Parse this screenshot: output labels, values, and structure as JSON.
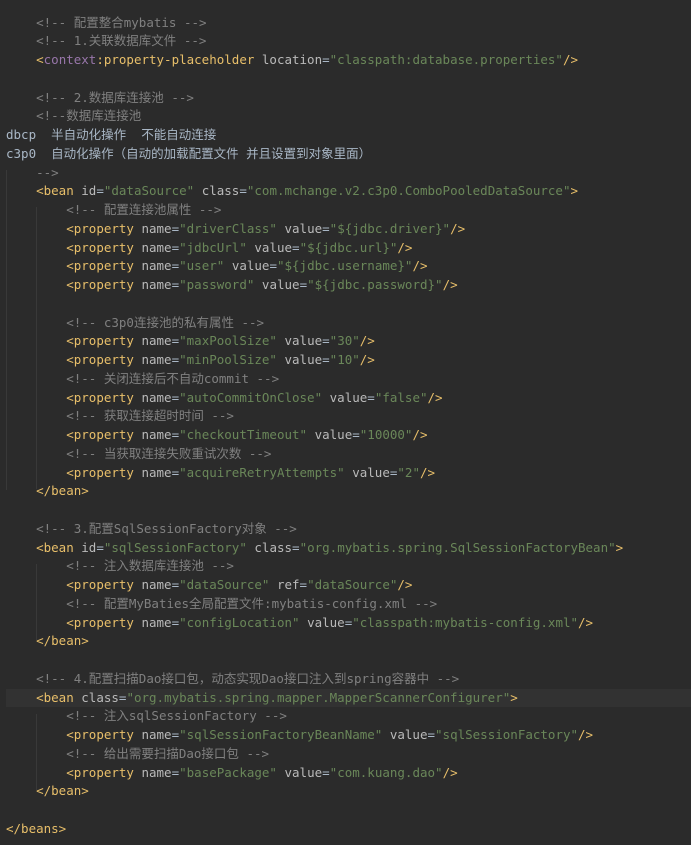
{
  "editor": {
    "colors": {
      "background": "#2b2b2b",
      "comment": "#808080",
      "tag": "#e8bf6a",
      "attribute": "#bababa",
      "value": "#6a8759",
      "namespace": "#9876aa",
      "text": "#a9b7c6"
    },
    "lines": [
      [
        {
          "t": "plain",
          "v": "    "
        },
        {
          "t": "comment",
          "v": "<!-- 配置整合mybatis -->"
        }
      ],
      [
        {
          "t": "plain",
          "v": "    "
        },
        {
          "t": "comment",
          "v": "<!-- 1.关联数据库文件 -->"
        }
      ],
      [
        {
          "t": "plain",
          "v": "    "
        },
        {
          "t": "tag",
          "v": "<"
        },
        {
          "t": "ns",
          "v": "context"
        },
        {
          "t": "tag",
          "v": ":property-placeholder "
        },
        {
          "t": "attr",
          "v": "location"
        },
        {
          "t": "plain",
          "v": "="
        },
        {
          "t": "val",
          "v": "\"classpath:database.properties\""
        },
        {
          "t": "tag",
          "v": "/>"
        }
      ],
      [],
      [
        {
          "t": "plain",
          "v": "    "
        },
        {
          "t": "comment",
          "v": "<!-- 2.数据库连接池 -->"
        }
      ],
      [
        {
          "t": "plain",
          "v": "    "
        },
        {
          "t": "comment",
          "v": "<!--数据库连接池"
        }
      ],
      [
        {
          "t": "text",
          "v": "dbcp  半自动化操作  不能自动连接"
        }
      ],
      [
        {
          "t": "text",
          "v": "c3p0  自动化操作（自动的加载配置文件 并且设置到对象里面）"
        }
      ],
      [
        {
          "t": "plain",
          "v": "    "
        },
        {
          "t": "comment",
          "v": "-->"
        }
      ],
      [
        {
          "t": "plain",
          "v": "    "
        },
        {
          "t": "tag",
          "v": "<bean "
        },
        {
          "t": "attr",
          "v": "id"
        },
        {
          "t": "plain",
          "v": "="
        },
        {
          "t": "val",
          "v": "\"dataSource\""
        },
        {
          "t": "plain",
          "v": " "
        },
        {
          "t": "attr",
          "v": "class"
        },
        {
          "t": "plain",
          "v": "="
        },
        {
          "t": "val",
          "v": "\"com.mchange.v2.c3p0.ComboPooledDataSource\""
        },
        {
          "t": "tag",
          "v": ">"
        }
      ],
      [
        {
          "t": "plain",
          "v": "        "
        },
        {
          "t": "comment",
          "v": "<!-- 配置连接池属性 -->"
        }
      ],
      [
        {
          "t": "plain",
          "v": "        "
        },
        {
          "t": "tag",
          "v": "<property "
        },
        {
          "t": "attr",
          "v": "name"
        },
        {
          "t": "plain",
          "v": "="
        },
        {
          "t": "val",
          "v": "\"driverClass\""
        },
        {
          "t": "plain",
          "v": " "
        },
        {
          "t": "attr",
          "v": "value"
        },
        {
          "t": "plain",
          "v": "="
        },
        {
          "t": "val",
          "v": "\"${jdbc.driver}\""
        },
        {
          "t": "tag",
          "v": "/>"
        }
      ],
      [
        {
          "t": "plain",
          "v": "        "
        },
        {
          "t": "tag",
          "v": "<property "
        },
        {
          "t": "attr",
          "v": "name"
        },
        {
          "t": "plain",
          "v": "="
        },
        {
          "t": "val",
          "v": "\"jdbcUrl\""
        },
        {
          "t": "plain",
          "v": " "
        },
        {
          "t": "attr",
          "v": "value"
        },
        {
          "t": "plain",
          "v": "="
        },
        {
          "t": "val",
          "v": "\"${jdbc.url}\""
        },
        {
          "t": "tag",
          "v": "/>"
        }
      ],
      [
        {
          "t": "plain",
          "v": "        "
        },
        {
          "t": "tag",
          "v": "<property "
        },
        {
          "t": "attr",
          "v": "name"
        },
        {
          "t": "plain",
          "v": "="
        },
        {
          "t": "val",
          "v": "\"user\""
        },
        {
          "t": "plain",
          "v": " "
        },
        {
          "t": "attr",
          "v": "value"
        },
        {
          "t": "plain",
          "v": "="
        },
        {
          "t": "val",
          "v": "\"${jdbc.username}\""
        },
        {
          "t": "tag",
          "v": "/>"
        }
      ],
      [
        {
          "t": "plain",
          "v": "        "
        },
        {
          "t": "tag",
          "v": "<property "
        },
        {
          "t": "attr",
          "v": "name"
        },
        {
          "t": "plain",
          "v": "="
        },
        {
          "t": "val",
          "v": "\"password\""
        },
        {
          "t": "plain",
          "v": " "
        },
        {
          "t": "attr",
          "v": "value"
        },
        {
          "t": "plain",
          "v": "="
        },
        {
          "t": "val",
          "v": "\"${jdbc.password}\""
        },
        {
          "t": "tag",
          "v": "/>"
        }
      ],
      [],
      [
        {
          "t": "plain",
          "v": "        "
        },
        {
          "t": "comment",
          "v": "<!-- c3p0连接池的私有属性 -->"
        }
      ],
      [
        {
          "t": "plain",
          "v": "        "
        },
        {
          "t": "tag",
          "v": "<property "
        },
        {
          "t": "attr",
          "v": "name"
        },
        {
          "t": "plain",
          "v": "="
        },
        {
          "t": "val",
          "v": "\"maxPoolSize\""
        },
        {
          "t": "plain",
          "v": " "
        },
        {
          "t": "attr",
          "v": "value"
        },
        {
          "t": "plain",
          "v": "="
        },
        {
          "t": "val",
          "v": "\"30\""
        },
        {
          "t": "tag",
          "v": "/>"
        }
      ],
      [
        {
          "t": "plain",
          "v": "        "
        },
        {
          "t": "tag",
          "v": "<property "
        },
        {
          "t": "attr",
          "v": "name"
        },
        {
          "t": "plain",
          "v": "="
        },
        {
          "t": "val",
          "v": "\"minPoolSize\""
        },
        {
          "t": "plain",
          "v": " "
        },
        {
          "t": "attr",
          "v": "value"
        },
        {
          "t": "plain",
          "v": "="
        },
        {
          "t": "val",
          "v": "\"10\""
        },
        {
          "t": "tag",
          "v": "/>"
        }
      ],
      [
        {
          "t": "plain",
          "v": "        "
        },
        {
          "t": "comment",
          "v": "<!-- 关闭连接后不自动commit -->"
        }
      ],
      [
        {
          "t": "plain",
          "v": "        "
        },
        {
          "t": "tag",
          "v": "<property "
        },
        {
          "t": "attr",
          "v": "name"
        },
        {
          "t": "plain",
          "v": "="
        },
        {
          "t": "val",
          "v": "\"autoCommitOnClose\""
        },
        {
          "t": "plain",
          "v": " "
        },
        {
          "t": "attr",
          "v": "value"
        },
        {
          "t": "plain",
          "v": "="
        },
        {
          "t": "val",
          "v": "\"false\""
        },
        {
          "t": "tag",
          "v": "/>"
        }
      ],
      [
        {
          "t": "plain",
          "v": "        "
        },
        {
          "t": "comment",
          "v": "<!-- 获取连接超时时间 -->"
        }
      ],
      [
        {
          "t": "plain",
          "v": "        "
        },
        {
          "t": "tag",
          "v": "<property "
        },
        {
          "t": "attr",
          "v": "name"
        },
        {
          "t": "plain",
          "v": "="
        },
        {
          "t": "val",
          "v": "\"checkoutTimeout\""
        },
        {
          "t": "plain",
          "v": " "
        },
        {
          "t": "attr",
          "v": "value"
        },
        {
          "t": "plain",
          "v": "="
        },
        {
          "t": "val",
          "v": "\"10000\""
        },
        {
          "t": "tag",
          "v": "/>"
        }
      ],
      [
        {
          "t": "plain",
          "v": "        "
        },
        {
          "t": "comment",
          "v": "<!-- 当获取连接失败重试次数 -->"
        }
      ],
      [
        {
          "t": "plain",
          "v": "        "
        },
        {
          "t": "tag",
          "v": "<property "
        },
        {
          "t": "attr",
          "v": "name"
        },
        {
          "t": "plain",
          "v": "="
        },
        {
          "t": "val",
          "v": "\"acquireRetryAttempts\""
        },
        {
          "t": "plain",
          "v": " "
        },
        {
          "t": "attr",
          "v": "value"
        },
        {
          "t": "plain",
          "v": "="
        },
        {
          "t": "val",
          "v": "\"2\""
        },
        {
          "t": "tag",
          "v": "/>"
        }
      ],
      [
        {
          "t": "plain",
          "v": "    "
        },
        {
          "t": "tag",
          "v": "</bean>"
        }
      ],
      [],
      [
        {
          "t": "plain",
          "v": "    "
        },
        {
          "t": "comment",
          "v": "<!-- 3.配置SqlSessionFactory对象 -->"
        }
      ],
      [
        {
          "t": "plain",
          "v": "    "
        },
        {
          "t": "tag",
          "v": "<bean "
        },
        {
          "t": "attr",
          "v": "id"
        },
        {
          "t": "plain",
          "v": "="
        },
        {
          "t": "val",
          "v": "\"sqlSessionFactory\""
        },
        {
          "t": "plain",
          "v": " "
        },
        {
          "t": "attr",
          "v": "class"
        },
        {
          "t": "plain",
          "v": "="
        },
        {
          "t": "val",
          "v": "\"org.mybatis.spring.SqlSessionFactoryBean\""
        },
        {
          "t": "tag",
          "v": ">"
        }
      ],
      [
        {
          "t": "plain",
          "v": "        "
        },
        {
          "t": "comment",
          "v": "<!-- 注入数据库连接池 -->"
        }
      ],
      [
        {
          "t": "plain",
          "v": "        "
        },
        {
          "t": "tag",
          "v": "<property "
        },
        {
          "t": "attr",
          "v": "name"
        },
        {
          "t": "plain",
          "v": "="
        },
        {
          "t": "val",
          "v": "\"dataSource\""
        },
        {
          "t": "plain",
          "v": " "
        },
        {
          "t": "attr",
          "v": "ref"
        },
        {
          "t": "plain",
          "v": "="
        },
        {
          "t": "val",
          "v": "\"dataSource\""
        },
        {
          "t": "tag",
          "v": "/>"
        }
      ],
      [
        {
          "t": "plain",
          "v": "        "
        },
        {
          "t": "comment",
          "v": "<!-- 配置MyBaties全局配置文件:mybatis-config.xml -->"
        }
      ],
      [
        {
          "t": "plain",
          "v": "        "
        },
        {
          "t": "tag",
          "v": "<property "
        },
        {
          "t": "attr",
          "v": "name"
        },
        {
          "t": "plain",
          "v": "="
        },
        {
          "t": "val",
          "v": "\"configLocation\""
        },
        {
          "t": "plain",
          "v": " "
        },
        {
          "t": "attr",
          "v": "value"
        },
        {
          "t": "plain",
          "v": "="
        },
        {
          "t": "val",
          "v": "\"classpath:mybatis-config.xml\""
        },
        {
          "t": "tag",
          "v": "/>"
        }
      ],
      [
        {
          "t": "plain",
          "v": "    "
        },
        {
          "t": "tag",
          "v": "</bean>"
        }
      ],
      [],
      [
        {
          "t": "plain",
          "v": "    "
        },
        {
          "t": "comment",
          "v": "<!-- 4.配置扫描Dao接口包，动态实现Dao接口注入到spring容器中 -->"
        }
      ],
      [
        {
          "t": "plain",
          "v": "    "
        },
        {
          "t": "tag",
          "v": "<bean "
        },
        {
          "t": "attr",
          "v": "class"
        },
        {
          "t": "plain",
          "v": "="
        },
        {
          "t": "val",
          "v": "\"org.mybatis.spring.mapper.MapperScannerConfigurer\""
        },
        {
          "t": "tag",
          "v": ">"
        }
      ],
      [
        {
          "t": "plain",
          "v": "        "
        },
        {
          "t": "comment",
          "v": "<!-- 注入sqlSessionFactory -->"
        }
      ],
      [
        {
          "t": "plain",
          "v": "        "
        },
        {
          "t": "tag",
          "v": "<property "
        },
        {
          "t": "attr",
          "v": "name"
        },
        {
          "t": "plain",
          "v": "="
        },
        {
          "t": "val",
          "v": "\"sqlSessionFactoryBeanName\""
        },
        {
          "t": "plain",
          "v": " "
        },
        {
          "t": "attr",
          "v": "value"
        },
        {
          "t": "plain",
          "v": "="
        },
        {
          "t": "val",
          "v": "\"sqlSessionFactory\""
        },
        {
          "t": "tag",
          "v": "/>"
        }
      ],
      [
        {
          "t": "plain",
          "v": "        "
        },
        {
          "t": "comment",
          "v": "<!-- 给出需要扫描Dao接口包 -->"
        }
      ],
      [
        {
          "t": "plain",
          "v": "        "
        },
        {
          "t": "tag",
          "v": "<property "
        },
        {
          "t": "attr",
          "v": "name"
        },
        {
          "t": "plain",
          "v": "="
        },
        {
          "t": "val",
          "v": "\"basePackage\""
        },
        {
          "t": "plain",
          "v": " "
        },
        {
          "t": "attr",
          "v": "value"
        },
        {
          "t": "plain",
          "v": "="
        },
        {
          "t": "val",
          "v": "\"com.kuang.dao\""
        },
        {
          "t": "tag",
          "v": "/>"
        }
      ],
      [
        {
          "t": "plain",
          "v": "    "
        },
        {
          "t": "tag",
          "v": "</bean>"
        }
      ],
      [],
      [
        {
          "t": "tag",
          "v": "</beans>"
        }
      ]
    ]
  }
}
